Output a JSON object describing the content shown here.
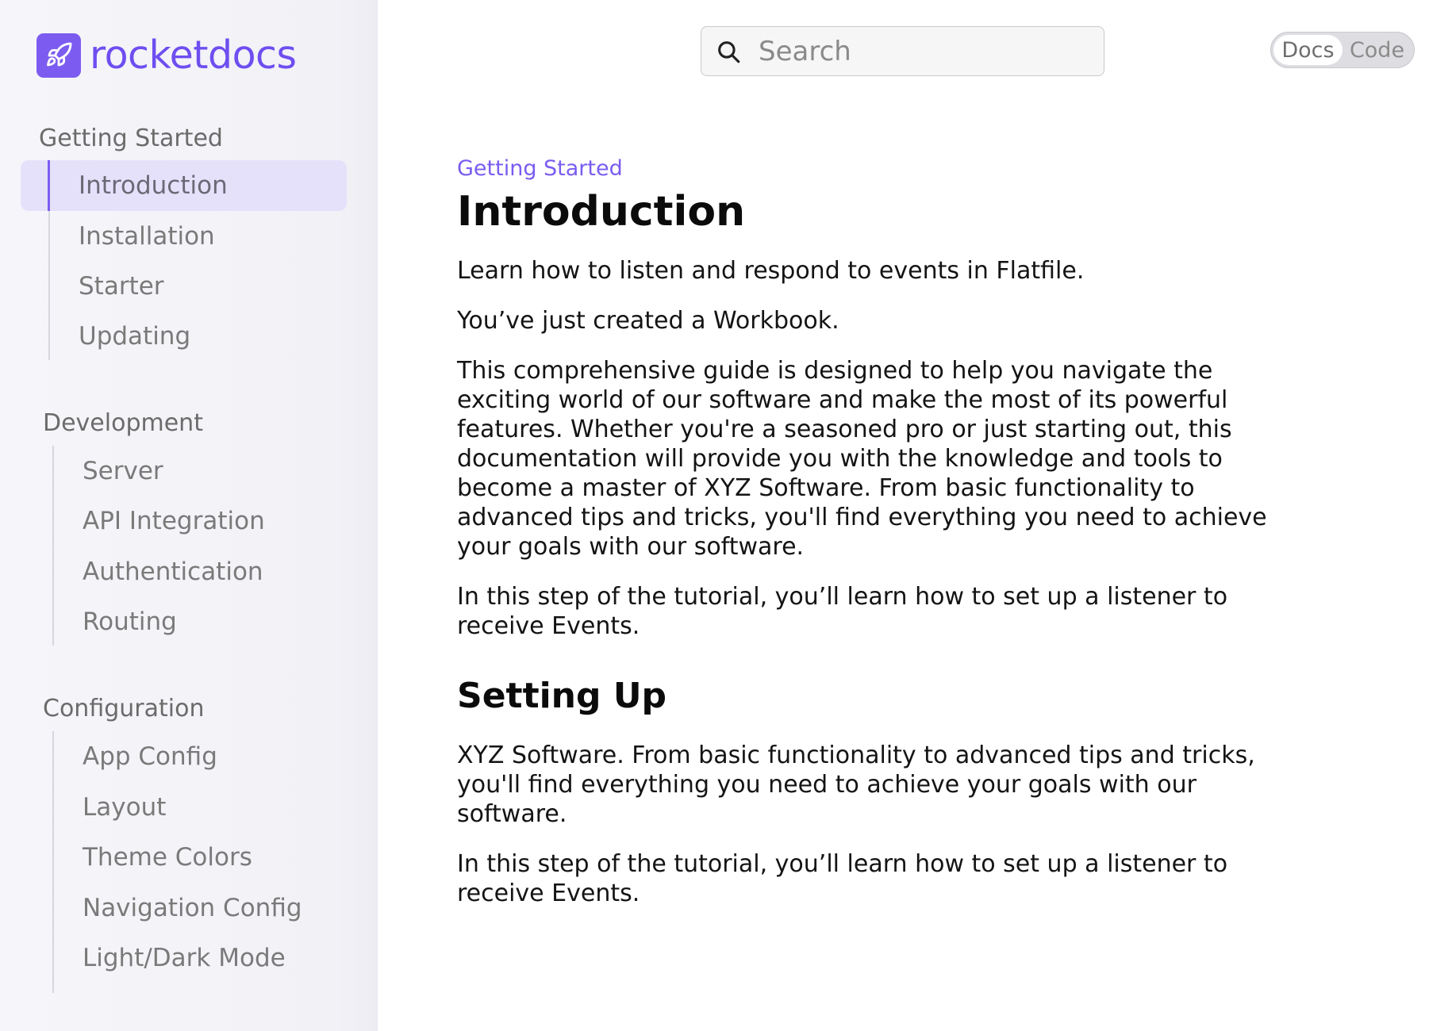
{
  "brand": {
    "name": "rocketdocs",
    "logo_icon": "rocket-icon",
    "accent": "#7c5cf0"
  },
  "search": {
    "placeholder": "Search",
    "value": ""
  },
  "view_toggle": {
    "options": [
      "Docs",
      "Code"
    ],
    "selected": "Docs"
  },
  "sidebar": {
    "sections": [
      {
        "heading": "Getting Started",
        "items": [
          "Introduction",
          "Installation",
          "Starter",
          "Updating"
        ],
        "active": "Introduction"
      },
      {
        "heading": "Development",
        "items": [
          "Server",
          "API Integration",
          "Authentication",
          "Routing"
        ]
      },
      {
        "heading": "Configuration",
        "items": [
          "App Config",
          "Layout",
          "Theme Colors",
          "Navigation Config",
          "Light/Dark Mode"
        ]
      }
    ]
  },
  "article": {
    "breadcrumb": "Getting Started",
    "title": "Introduction",
    "intro": [
      "Learn how to listen and respond to events in Flatfile.",
      "You’ve just created a Workbook.",
      "This comprehensive guide is designed to help you navigate the exciting world of our software and make the most of its powerful features. Whether you're a seasoned pro or just starting out, this documentation will provide you with the knowledge and tools to become a master of XYZ Software. From basic functionality to advanced tips and tricks, you'll find everything you need to achieve your goals with our software.",
      "In this step of the tutorial, you’ll learn how to set up a listener to receive Events."
    ],
    "section_title": "Setting Up",
    "section_paragraphs": [
      "XYZ Software. From basic functionality to advanced tips and tricks, you'll find everything you need to achieve your goals with our software.",
      "In this step of the tutorial, you’ll learn how to set up a listener to receive Events."
    ]
  }
}
